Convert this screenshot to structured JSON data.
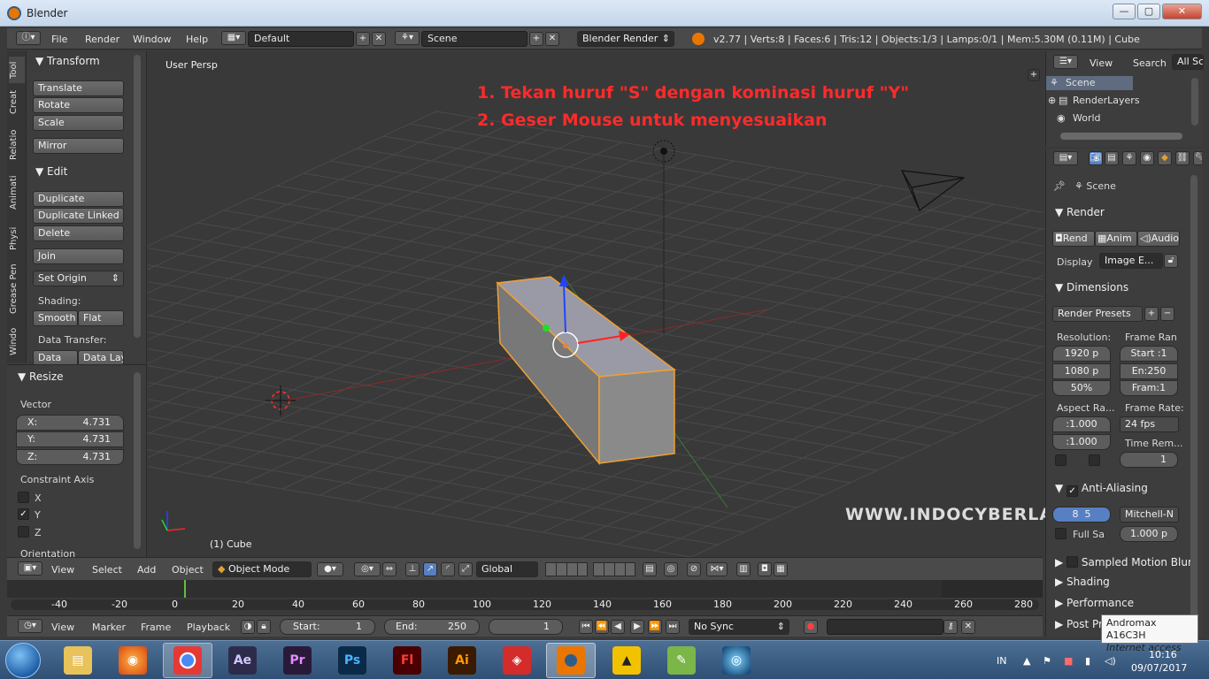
{
  "window": {
    "title": "Blender",
    "minimize": "—",
    "maximize": "▢",
    "close": "✕"
  },
  "infobar": {
    "menus": [
      "File",
      "Render",
      "Window",
      "Help"
    ],
    "screen_layout": "Default",
    "scene": "Scene",
    "engine": "Blender Render",
    "stats": "v2.77 | Verts:8 | Faces:6 | Tris:12 | Objects:1/3 | Lamps:0/1 | Mem:5.30M (0.11M) | Cube"
  },
  "toolshelf": {
    "tabs": [
      "Tool",
      "Creat",
      "Relatio",
      "Animati",
      "Physi",
      "Grease Pen",
      "Windo"
    ],
    "transform": {
      "header": "Transform",
      "buttons": [
        "Translate",
        "Rotate",
        "Scale",
        "Mirror"
      ]
    },
    "edit": {
      "header": "Edit",
      "buttons": [
        "Duplicate",
        "Duplicate Linked",
        "Delete",
        "Join",
        "Set Origin"
      ]
    },
    "shading": {
      "label": "Shading:",
      "smooth": "Smooth",
      "flat": "Flat"
    },
    "data_transfer": {
      "label": "Data Transfer:",
      "data": "Data",
      "data_layout": "Data Lay"
    }
  },
  "operator": {
    "header": "Resize",
    "vector_label": "Vector",
    "x": {
      "label": "X:",
      "value": "4.731"
    },
    "y": {
      "label": "Y:",
      "value": "4.731"
    },
    "z": {
      "label": "Z:",
      "value": "4.731"
    },
    "constraint_label": "Constraint Axis",
    "axes": [
      {
        "label": "X",
        "checked": false
      },
      {
        "label": "Y",
        "checked": true
      },
      {
        "label": "Z",
        "checked": false
      }
    ],
    "orientation_label": "Orientation"
  },
  "viewport": {
    "view_name": "User Persp",
    "object_name": "(1) Cube",
    "instructions": [
      "1. Tekan huruf \"S\" dengan kominasi huruf \"Y\"",
      "2.  Geser Mouse untuk menyesuaikan"
    ],
    "watermark": "WWW.INDOCYBERLAB.COM"
  },
  "viewport_header": {
    "menus": [
      "View",
      "Select",
      "Add",
      "Object"
    ],
    "mode": "Object Mode",
    "orientation": "Global"
  },
  "timeline": {
    "ticks": [
      "-40",
      "-20",
      "0",
      "20",
      "40",
      "60",
      "80",
      "100",
      "120",
      "140",
      "160",
      "180",
      "200",
      "220",
      "240",
      "260",
      "280"
    ]
  },
  "timeline_header": {
    "menus": [
      "View",
      "Marker",
      "Frame",
      "Playback"
    ],
    "start_label": "Start:",
    "start_value": "1",
    "end_label": "End:",
    "end_value": "250",
    "current": "1",
    "sync": "No Sync"
  },
  "outliner": {
    "menus": [
      "View",
      "Search"
    ],
    "filter": "All Sc",
    "items": [
      "Scene",
      "RenderLayers",
      "World"
    ]
  },
  "properties": {
    "context": "Scene",
    "render": {
      "header": "Render",
      "render_btn": "Rend",
      "anim_btn": "Anim",
      "audio_btn": "Audio",
      "display_label": "Display",
      "display_value": "Image E..."
    },
    "dimensions": {
      "header": "Dimensions",
      "presets": "Render Presets",
      "resolution_label": "Resolution:",
      "res_x": "1920 p",
      "res_y": "1080 p",
      "res_pct": "50%",
      "frame_range_label": "Frame Ran",
      "start": "Start :1",
      "end": "En:250",
      "step": "Fram:1",
      "aspect_label": "Aspect Ra...",
      "aspect_x": ":1.000",
      "aspect_y": ":1.000",
      "frame_rate_label": "Frame Rate:",
      "fps": "24 fps",
      "time_remap_label": "Time Rem...",
      "time_remap_value": "1"
    },
    "antialiasing": {
      "header": "Anti-Aliasing",
      "samples": "8",
      "samples2": "5",
      "filter": "Mitchell-N",
      "full_sample": "Full Sa",
      "filter_size": "1.000 p"
    },
    "motion_blur": "Sampled Motion Blur",
    "shading": "Shading",
    "performance": "Performance",
    "post_processing": "Post Pro"
  },
  "taskbar": {
    "apps": [
      "Explorer",
      "Firefox",
      "Chrome",
      "Ae",
      "Pr",
      "Ps",
      "Fl",
      "Ai",
      "SketchUp",
      "Blender",
      "ArchiCAD",
      "Android",
      "Media"
    ],
    "lang": "IN",
    "time": "10:16",
    "date": "09/07/2017"
  },
  "tooltip": {
    "title": "Andromax A16C3H",
    "subtitle": "Internet access"
  },
  "colors": {
    "accent": "#ea7600",
    "selected": "#5680c2",
    "instruction": "#ff2a2a"
  }
}
